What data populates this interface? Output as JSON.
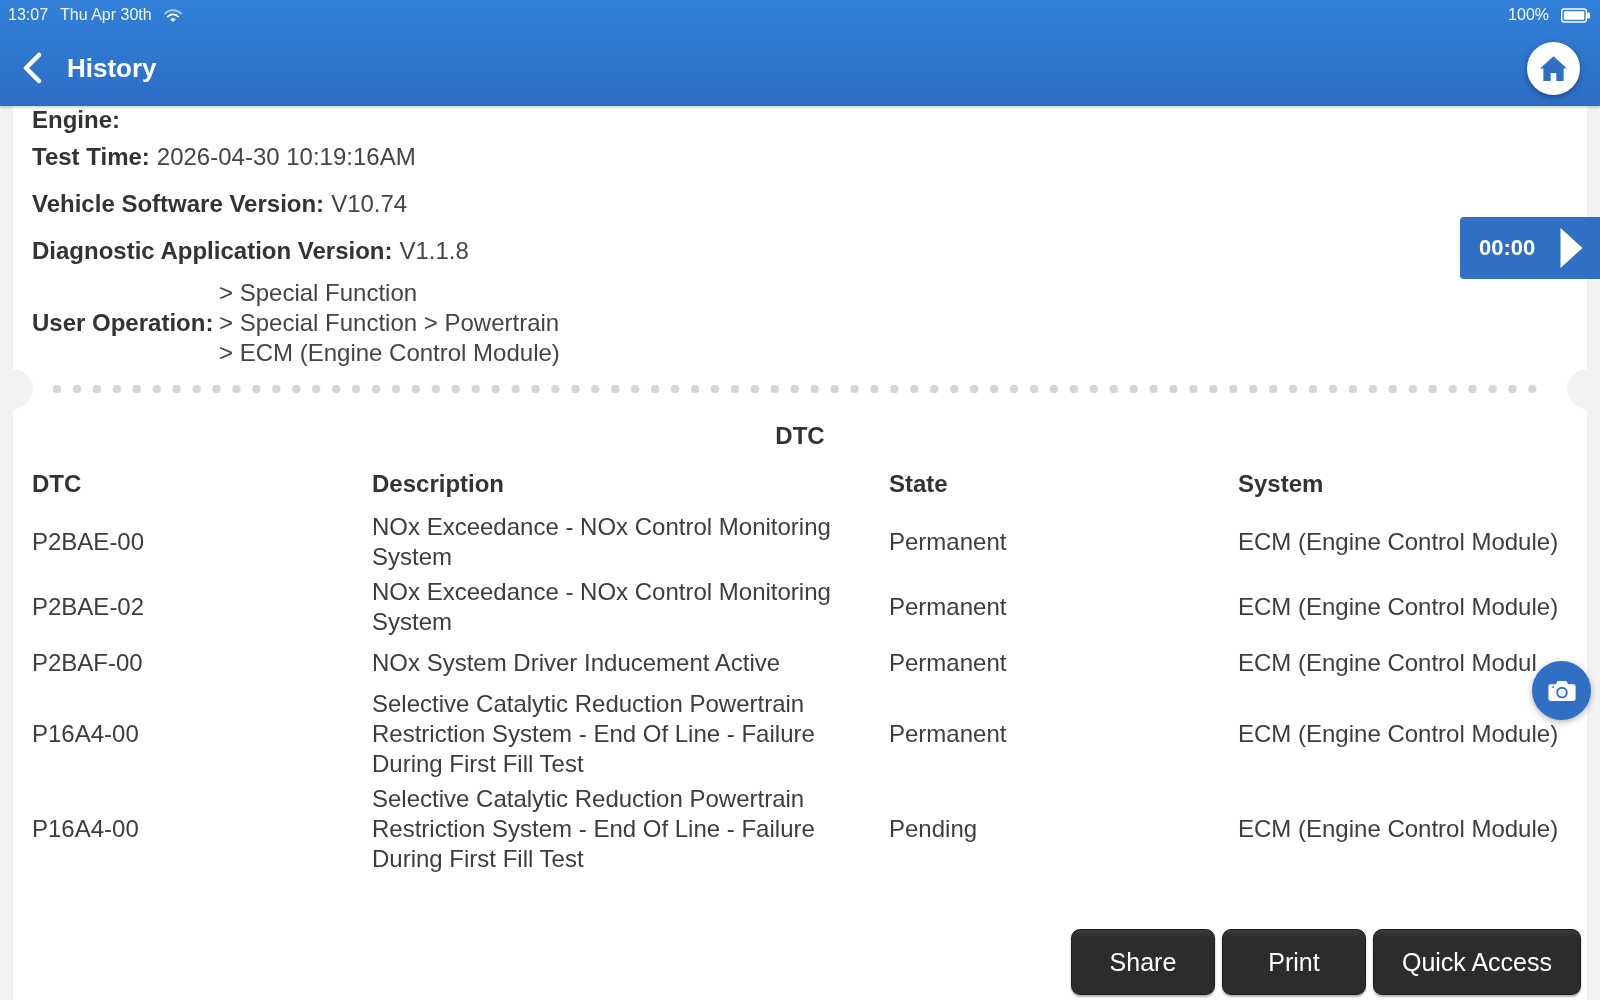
{
  "status_bar": {
    "time": "13:07",
    "date": "Thu Apr 30th",
    "battery": "100%"
  },
  "header": {
    "title": "History"
  },
  "info": [
    {
      "label": "Engine:"
    },
    {
      "label": "Test Time:",
      "value": "2026-04-30 10:19:16AM"
    },
    {
      "label": "Vehicle Software Version:",
      "value": "V10.74"
    },
    {
      "label": "Diagnostic Application Version:",
      "value": "V1.1.8"
    }
  ],
  "user_operation": {
    "label": "User Operation:",
    "steps": [
      "> Special Function",
      "> Special Function > Powertrain",
      "> ECM (Engine Control Module)"
    ]
  },
  "playback": {
    "time": "00:00"
  },
  "dtc_table": {
    "title": "DTC",
    "columns": [
      "DTC",
      "Description",
      "State",
      "System"
    ],
    "rows": [
      {
        "code": "P2BAE-00",
        "description": "NOx Exceedance - NOx Control Monitoring System",
        "state": "Permanent",
        "system": "ECM (Engine Control Module)"
      },
      {
        "code": "P2BAE-02",
        "description": "NOx Exceedance - NOx Control Monitoring System",
        "state": "Permanent",
        "system": "ECM (Engine Control Module)"
      },
      {
        "code": "P2BAF-00",
        "description": "NOx System Driver Inducement Active",
        "state": "Permanent",
        "system": "ECM (Engine Control Modul"
      },
      {
        "code": "P16A4-00",
        "description": "Selective Catalytic Reduction Powertrain Restriction System - End Of Line - Failure During First Fill Test",
        "state": "Permanent",
        "system": "ECM (Engine Control Module)"
      },
      {
        "code": "P16A4-00",
        "description": "Selective Catalytic Reduction Powertrain Restriction System - End Of Line - Failure During First Fill Test",
        "state": "Pending",
        "system": "ECM (Engine Control Module)"
      }
    ]
  },
  "buttons": [
    "Share",
    "Print",
    "Quick Access"
  ]
}
